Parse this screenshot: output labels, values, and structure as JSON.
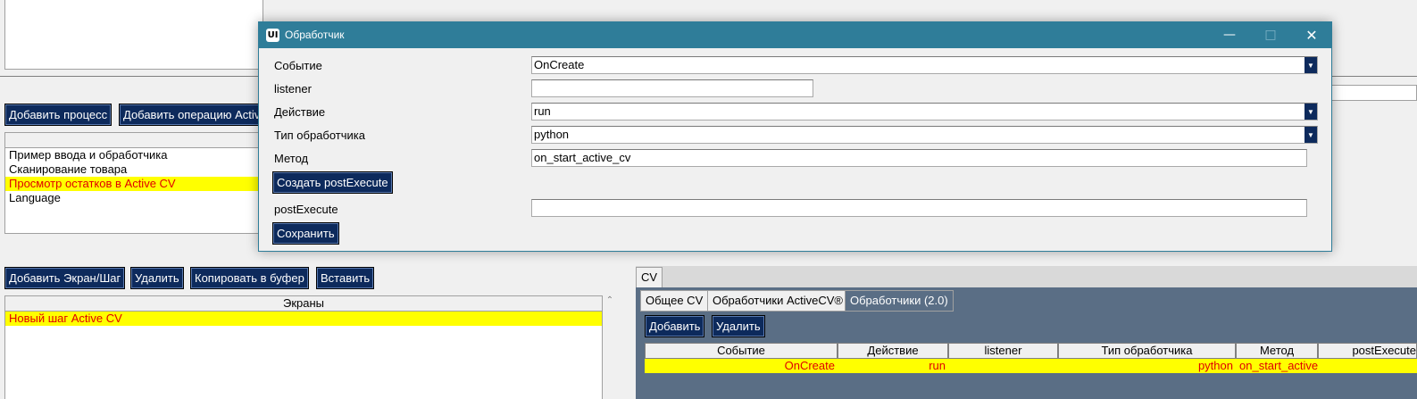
{
  "left": {
    "add_process_label": "Добавить процесс",
    "add_operation_label": "Добавить операцию ActiveCV",
    "processes": [
      {
        "label": "Пример ввода и обработчика",
        "selected": false
      },
      {
        "label": "Сканирование товара",
        "selected": false
      },
      {
        "label": "Просмотр остатков в Active CV",
        "selected": true
      },
      {
        "label": "Language",
        "selected": false
      }
    ],
    "screen_buttons": {
      "add": "Добавить Экран/Шаг",
      "delete": "Удалить",
      "copy": "Копировать в буфер",
      "paste": "Вставить"
    },
    "screens_header": "Экраны",
    "screens": [
      {
        "label": "Новый шаг Active CV",
        "selected": true
      }
    ]
  },
  "dialog": {
    "title": "Обработчик",
    "logo_text": "UI",
    "event_label": "Событие",
    "event_value": "OnCreate",
    "listener_label": "listener",
    "listener_value": "",
    "action_label": "Действие",
    "action_value": "run",
    "handler_type_label": "Тип обработчика",
    "handler_type_value": "python",
    "method_label": "Метод",
    "method_value": "on_start_active_cv",
    "create_post_label": "Создать postExecute",
    "post_label": "postExecute",
    "post_value": "",
    "save_label": "Сохранить"
  },
  "cv": {
    "outer_tab": "CV",
    "tabs": [
      "Общее CV",
      "Обработчики ActiveCV®",
      "Обработчики (2.0)"
    ],
    "add_label": "Добавить",
    "delete_label": "Удалить",
    "columns": [
      "Событие",
      "Действие",
      "listener",
      "Тип обработчика",
      "Метод",
      "postExecute"
    ],
    "rows": [
      {
        "event": "OnCreate",
        "action": "run",
        "listener": "",
        "type": "python",
        "method": "on_start_active_cv",
        "post": ""
      }
    ]
  },
  "colors": {
    "navy": "#0d2a5c",
    "titlebar": "#2f7d99",
    "highlight": "#ffff00",
    "highlight_text": "#e00000",
    "panel_slate": "#5a6e85"
  }
}
